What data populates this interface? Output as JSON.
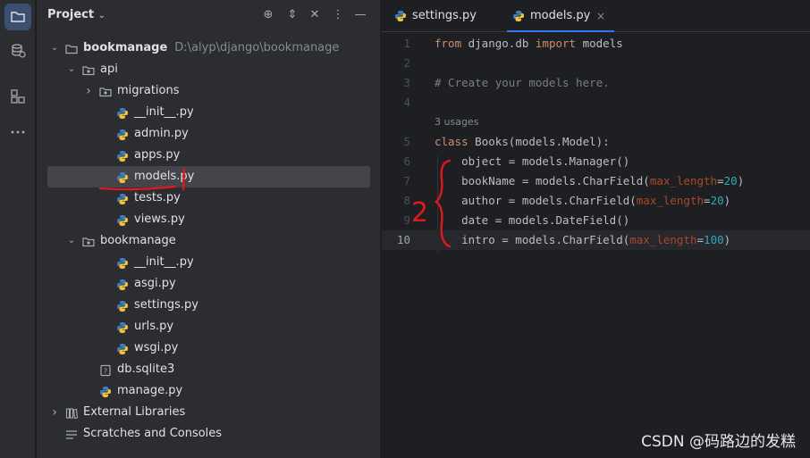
{
  "toolstrip": {
    "items": [
      {
        "icon": "folder-icon"
      },
      {
        "icon": "database-icon"
      },
      {
        "icon": "structure-icon"
      },
      {
        "icon": "more-icon"
      }
    ]
  },
  "project_panel": {
    "title": "Project",
    "tree": [
      {
        "label": "bookmanage",
        "path": "D:\\alyp\\django\\bookmanage",
        "icon": "folder-icon",
        "expanded": true
      },
      {
        "label": "api",
        "icon": "package-icon",
        "expanded": true
      },
      {
        "label": "migrations",
        "icon": "package-icon",
        "expanded": false
      },
      {
        "label": "__init__.py",
        "icon": "python-icon"
      },
      {
        "label": "admin.py",
        "icon": "python-icon"
      },
      {
        "label": "apps.py",
        "icon": "python-icon"
      },
      {
        "label": "models.py",
        "icon": "python-icon",
        "selected": true
      },
      {
        "label": "tests.py",
        "icon": "python-icon"
      },
      {
        "label": "views.py",
        "icon": "python-icon"
      },
      {
        "label": "bookmanage",
        "icon": "package-icon",
        "expanded": true
      },
      {
        "label": "__init__.py",
        "icon": "python-icon"
      },
      {
        "label": "asgi.py",
        "icon": "python-icon"
      },
      {
        "label": "settings.py",
        "icon": "python-icon"
      },
      {
        "label": "urls.py",
        "icon": "python-icon"
      },
      {
        "label": "wsgi.py",
        "icon": "python-icon"
      },
      {
        "label": "db.sqlite3",
        "icon": "unknown-file-icon"
      },
      {
        "label": "manage.py",
        "icon": "python-icon"
      },
      {
        "label": "External Libraries",
        "icon": "library-icon",
        "expanded": false
      },
      {
        "label": "Scratches and Consoles",
        "icon": "scratches-icon"
      }
    ]
  },
  "editor": {
    "tabs": [
      {
        "label": "settings.py",
        "active": false
      },
      {
        "label": "models.py",
        "active": true,
        "close": "×"
      }
    ],
    "usages_hint": "3 usages",
    "line_numbers": [
      "1",
      "2",
      "3",
      "4",
      "5",
      "6",
      "7",
      "8",
      "9",
      "10"
    ],
    "code": {
      "l1_kw1": "from",
      "l1_mod": " django.db ",
      "l1_kw2": "import",
      "l1_name": " models",
      "l3_comment": "# Create your models here.",
      "l5_kw": "class",
      "l5_rest": " Books(models.Model):",
      "l6": "    object = models.Manager()",
      "l7_a": "    bookName = models.CharField(",
      "l7_p": "max_length",
      "l7_eq": "=",
      "l7_n": "20",
      "l7_c": ")",
      "l8_a": "    author = models.CharField(",
      "l8_p": "max_length",
      "l8_eq": "=",
      "l8_n": "20",
      "l8_c": ")",
      "l9": "    date = models.DateField()",
      "l10_a": "    intro = models.CharField(",
      "l10_p": "max_length",
      "l10_eq": "=",
      "l10_n": "100",
      "l10_c": ")"
    }
  },
  "annotation": {
    "number": "2",
    "color": "#e0191c"
  },
  "watermark": "CSDN @码路边的发糕"
}
